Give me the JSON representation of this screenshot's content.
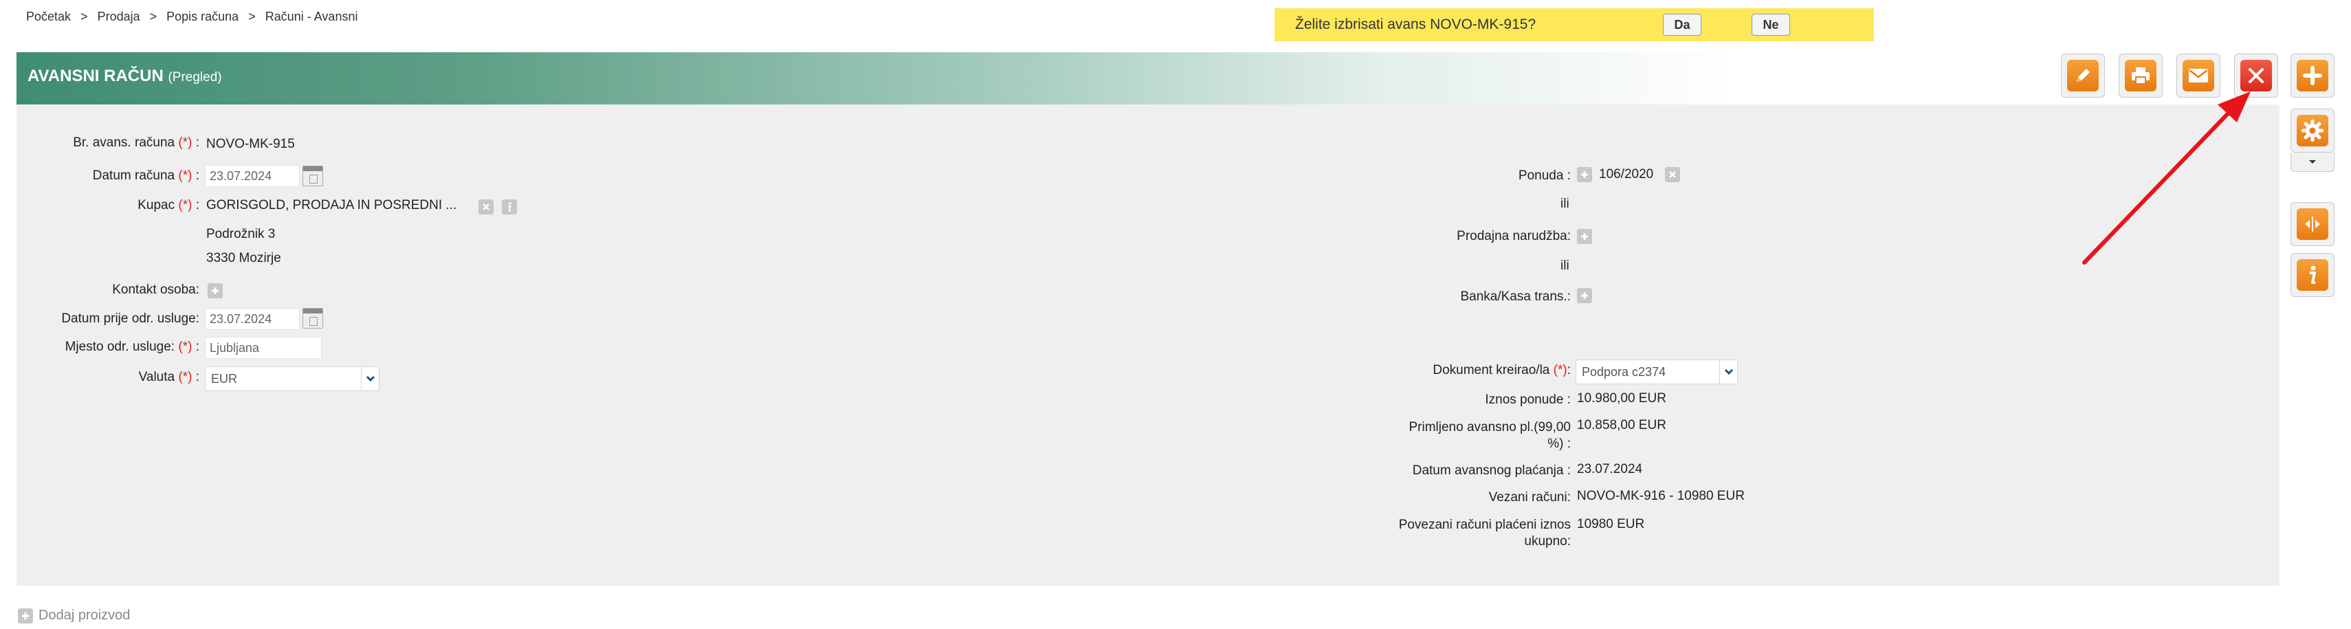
{
  "breadcrumb": [
    "Početak",
    "Prodaja",
    "Popis računa",
    "Računi - Avansni"
  ],
  "breadcrumb_separator": ">",
  "confirm": {
    "message": "Želite izbrisati avans NOVO-MK-915?",
    "yes_label": "Da",
    "no_label": "Ne",
    "background": "#fde85a"
  },
  "header": {
    "title": "AVANSNI RAČUN",
    "subtitle": "(Pregled)",
    "accent": "#3f8d72"
  },
  "toolbar": {
    "edit_icon": "pencil-icon",
    "print_icon": "printer-icon",
    "email_icon": "envelope-icon",
    "delete_icon": "close-icon",
    "add_icon": "plus-icon",
    "settings_icon": "gear-icon",
    "dropdown_icon": "caret-down-icon",
    "split_icon": "split-arrows-icon",
    "info_icon": "info-icon"
  },
  "form_left": {
    "br_label": "Br. avans. računa",
    "br_value": "NOVO-MK-915",
    "datum_label": "Datum računa",
    "datum_value": "23.07.2024",
    "kupac_label": "Kupac",
    "kupac_value": "GORISGOLD, PRODAJA IN POSREDNI ...",
    "address_line1": "Podrožnik 3",
    "address_line2": "3330 Mozirje",
    "kontakt_label": "Kontakt osoba:",
    "datum_prije_label": "Datum prije odr. usluge:",
    "datum_prije_value": "23.07.2024",
    "mjesto_label": "Mjesto odr. usluge:",
    "mjesto_value": "Ljubljana",
    "valuta_label": "Valuta",
    "valuta_value": "EUR",
    "required_mark": "(*)",
    "colon": ":"
  },
  "form_right": {
    "ponuda_label": "Ponuda :",
    "ponuda_value": "106/2020",
    "ili1": "ili",
    "narudzba_label": "Prodajna narudžba:",
    "ili2": "ili",
    "banka_label": "Banka/Kasa trans.:",
    "kreirao_label": "Dokument kreirao/la",
    "kreirao_value": "Podpora c2374",
    "iznos_label": "Iznos ponude :",
    "iznos_value": "10.980,00 EUR",
    "primljeno_label_1": "Primljeno avansno pl.(99,00",
    "primljeno_label_2": "%) :",
    "primljeno_value": "10.858,00 EUR",
    "datum_avans_label": "Datum avansnog plaćanja :",
    "datum_avans_value": "23.07.2024",
    "vezani_label": "Vezani računi:",
    "vezani_value": "NOVO-MK-916 - 10980 EUR",
    "povezani_label_1": "Povezani računi plaćeni iznos",
    "povezani_label_2": "ukupno:",
    "povezani_value": "10980 EUR"
  },
  "footer": {
    "add_product": "Dodaj proizvod"
  }
}
